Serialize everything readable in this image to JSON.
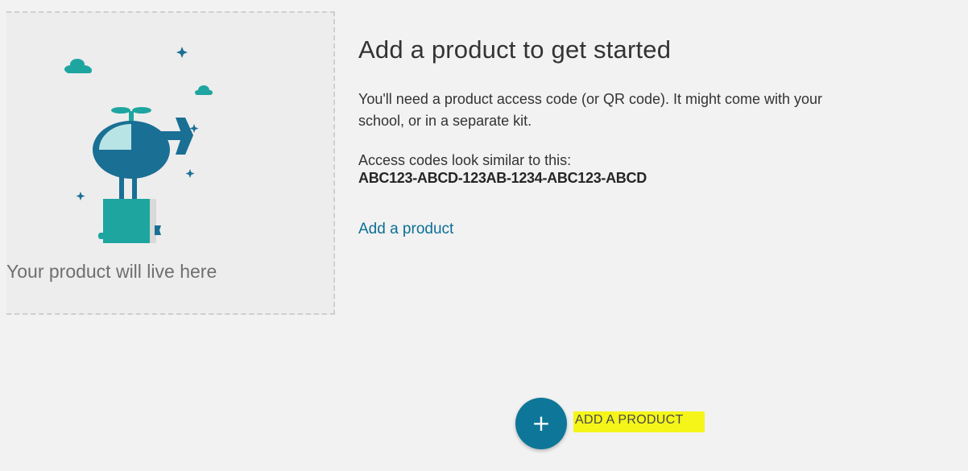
{
  "placeholder": {
    "caption": "Your product will live here",
    "illustration_icon": "helicopter-with-book-illustration"
  },
  "info": {
    "title": "Add a product to get started",
    "description_line1": "You'll need a product access code (or QR code). It might come with your",
    "description_line2": "school, or in a separate kit.",
    "codes_label": "Access codes look similar to this:",
    "code_example": "ABC123-ABCD-123AB-1234-ABC123-ABCD",
    "add_link": "Add a product"
  },
  "fab": {
    "icon": "plus-icon",
    "icon_glyph": "+",
    "label": "ADD A PRODUCT"
  },
  "colors": {
    "background": "#f2f2f2",
    "accent": "#0e7799",
    "link": "#0b6f95",
    "highlight": "#f5f51a",
    "illustration_teal": "#1ea5a0",
    "illustration_blue": "#1a6f94"
  }
}
